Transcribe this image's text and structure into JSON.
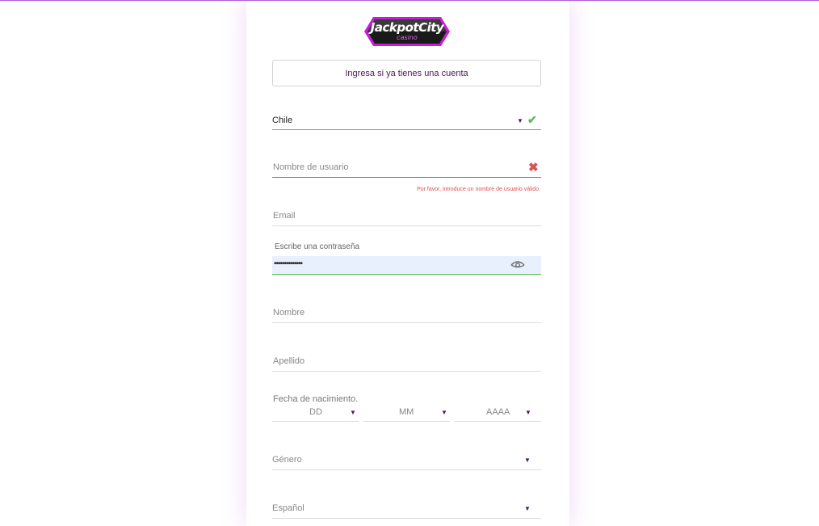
{
  "logo": {
    "name": "JackpotCity",
    "sub": "casino"
  },
  "login_button": "Ingresa si ya tienes una cuenta",
  "country": {
    "value": "Chile"
  },
  "username": {
    "placeholder": "Nombre de usuario",
    "error": "Por favor, introduce un nombre de usuario válido."
  },
  "email": {
    "placeholder": "Email"
  },
  "password": {
    "label": "Escribe una contraseña",
    "masked_value": "••••••••••••••"
  },
  "first_name": {
    "placeholder": "Nombre"
  },
  "last_name": {
    "placeholder": "Apellido"
  },
  "dob": {
    "label": "Fecha de nacimiento.",
    "day": "DD",
    "month": "MM",
    "year": "AAAA"
  },
  "gender": {
    "placeholder": "Género"
  },
  "language": {
    "value": "Español"
  },
  "icons": {
    "valid": "check-icon",
    "invalid": "cross-icon",
    "show_password": "eye-icon",
    "dropdown": "caret-down-icon"
  },
  "colors": {
    "accent": "#4a1a5e",
    "valid": "#5cb85c",
    "error": "#d9534f",
    "autofill": "#e8f0fe",
    "top_line": "#b05ad8"
  }
}
